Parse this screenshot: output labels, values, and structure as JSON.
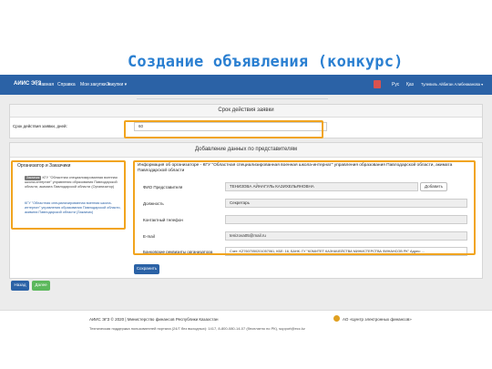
{
  "slide": {
    "title": "Создание объявления (конкурс)"
  },
  "navbar": {
    "brand": "АИИС ЭГЗ",
    "items": [
      "Главная",
      "Справка",
      "Мои закупки ▾",
      "Закупки ▾"
    ],
    "lang_ru": "Рус",
    "lang_kz": "Қаз",
    "user": "Тулевиль Айбиган Алибекманова ▾"
  },
  "term_panel": {
    "header": "Срок действия заявки",
    "label": "Срок действия заявки, дней:",
    "value": "60"
  },
  "rep_panel": {
    "header": "Добавление данных по представителям",
    "organizer_box": {
      "title": "Организатор и Заказчики",
      "badge": "Заказчик",
      "text": "КГУ \"Областная специализированная военная школа-интернат\" управления образования Павлодарской области, акимата Павлодарской области (Организатор)",
      "link": "КГУ \"Областная специализированная военная школа-интернат\" управления образования Павлодарской области, акимата Павлодарской области (Заказчик)"
    },
    "info_title": "Информация об организаторе - КГУ \"Областная специализированная военная школа-интернат\" управления образования Павлодарской области, акимата Павлодарской области",
    "fields": {
      "fio_label": "ФИО Представителя",
      "fio_value": "ТЕНИЗОВА АЙНАГУЛЬ КАЗИХЕЛЬЯНОВНА",
      "add_button": "Добавить",
      "position_label": "Должность",
      "position_value": "Секретарь",
      "phone_label": "Контактный телефон",
      "phone_value": "",
      "email_label": "E-mail",
      "email_value": "tenizova05@mail.ru",
      "bank_label": "Банковские реквизиты организатора",
      "bank_value": "Счет: KZ7607050201057061, КБЕ: 16, БАНК: ГУ \"КОМИТЕТ КАЗНАЧЕЙСТВА МИНИСТЕРСТВА ФИНАНСОВ РК\" Адрес: ..."
    },
    "save_button": "Сохранить"
  },
  "bottom_buttons": {
    "back": "Назад",
    "next": "Далее"
  },
  "footer": {
    "copyright": "АИИС ЭГЗ © 2020 | Министерство финансов Республики Казахстан",
    "support": "Техническая поддержка пользователей портала (24/7 без выходных): 1417, 8-800-080-14-07 (бесплатно по РК), support@ecc.kz",
    "partner": "АО «Центр электронных финансов»"
  }
}
